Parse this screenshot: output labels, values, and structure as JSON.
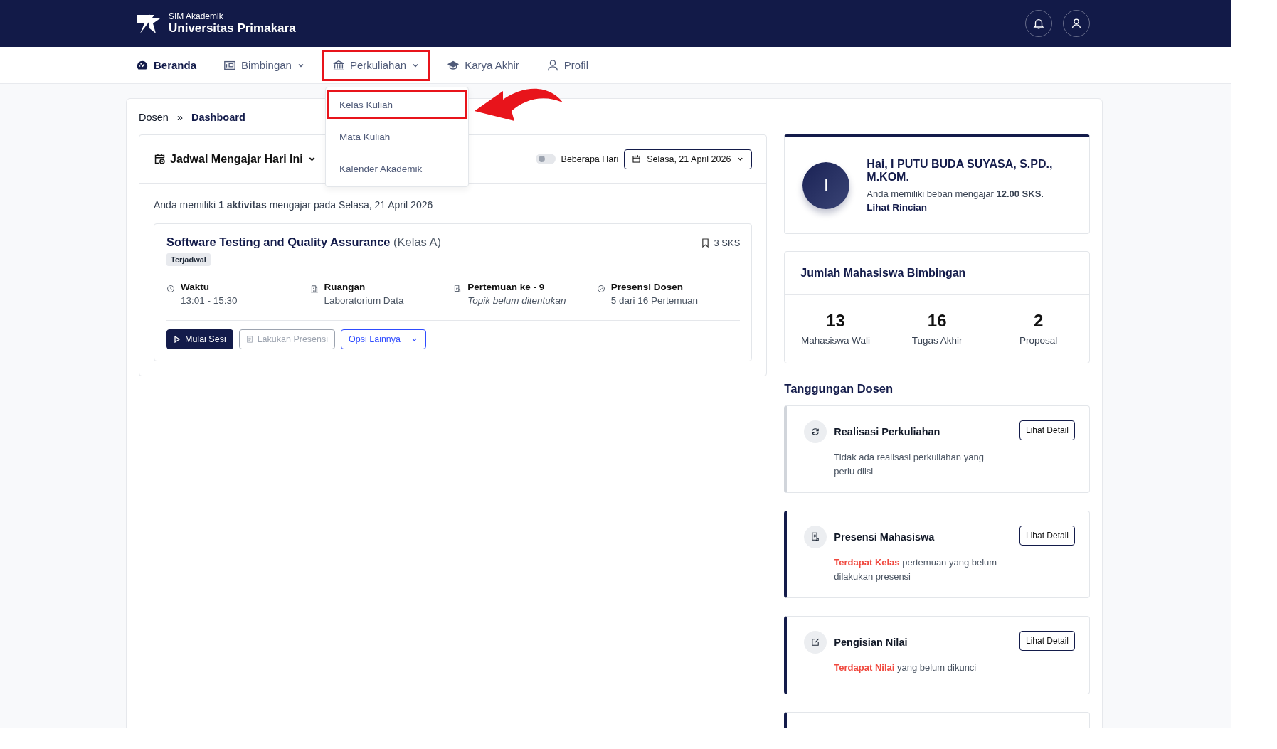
{
  "header": {
    "subtitle": "SIM Akademik",
    "title": "Universitas Primakara"
  },
  "nav": [
    {
      "label": "Beranda",
      "kind": "gauge",
      "selected": true,
      "has_menu": false,
      "highlighted": false
    },
    {
      "label": "Bimbingan",
      "kind": "board",
      "selected": false,
      "has_menu": true,
      "highlighted": false
    },
    {
      "label": "Perkuliahan",
      "kind": "bank",
      "selected": false,
      "has_menu": true,
      "highlighted": true,
      "menu": [
        {
          "label": "Kelas Kuliah",
          "highlighted": true
        },
        {
          "label": "Mata Kuliah",
          "highlighted": false
        },
        {
          "label": "Kalender Akademik",
          "highlighted": false
        }
      ]
    },
    {
      "label": "Karya Akhir",
      "kind": "cap",
      "selected": false,
      "has_menu": false,
      "highlighted": false
    },
    {
      "label": "Profil",
      "kind": "person",
      "selected": false,
      "has_menu": false,
      "highlighted": false
    }
  ],
  "breadcrumb": {
    "separator": "»",
    "items": [
      "Dosen",
      "Dashboard"
    ]
  },
  "schedule": {
    "title": "Jadwal Mengajar Hari Ini",
    "toggle": {
      "label": "Beberapa Hari",
      "on": false
    },
    "date": "Selasa, 21 April 2026",
    "summary": "Anda memiliki **1 aktivitas** mengajar pada Selasa, 21 April 2026",
    "courses": [
      {
        "title": "Software Testing and Quality Assurance",
        "class_label": "(Kelas A)",
        "status": "Terjadwal",
        "credits": "3 SKS",
        "info": [
          {
            "kind": "clock",
            "label": "Waktu",
            "value": "13:01 - 15:30",
            "italic": false
          },
          {
            "kind": "building",
            "label": "Ruangan",
            "value": "Laboratorium Data",
            "italic": false
          },
          {
            "kind": "document",
            "label": "Pertemuan ke - 9",
            "value": "Topik belum ditentukan",
            "italic": true
          },
          {
            "kind": "check",
            "label": "Presensi Dosen",
            "value": "5 dari 16 Pertemuan",
            "italic": false
          }
        ],
        "buttons": [
          {
            "kind": "primary",
            "label": "Mulai Sesi",
            "disabled": false
          },
          {
            "kind": "presence",
            "label": "Lakukan Presensi",
            "disabled": true
          },
          {
            "kind": "dropdown",
            "label": "Opsi Lainnya",
            "disabled": false
          }
        ]
      }
    ]
  },
  "profile": {
    "initial": "I",
    "greeting": "Hai, I PUTU BUDA SUYASA, S.PD., M.KOM.",
    "load": "Anda memiliki beban mengajar **12.00 SKS.**",
    "link": "Lihat Rincian"
  },
  "supervision": {
    "title": "Jumlah Mahasiswa Bimbingan",
    "stats": [
      {
        "value": "13",
        "label": "Mahasiswa Wali"
      },
      {
        "value": "16",
        "label": "Tugas Akhir"
      },
      {
        "value": "2",
        "label": "Proposal"
      }
    ]
  },
  "tasks": {
    "title": "Tanggungan Dosen",
    "items": [
      {
        "kind": "refresh",
        "title": "Realisasi Perkuliahan",
        "pending": false,
        "text": "Tidak ada realisasi perkuliahan yang perlu diisi",
        "button": "Lihat Detail"
      },
      {
        "kind": "document",
        "title": "Presensi Mahasiswa",
        "pending": true,
        "highlight": "Terdapat Kelas",
        "text": "pertemuan yang belum dilakukan presensi",
        "button": "Lihat Detail"
      },
      {
        "kind": "edit",
        "title": "Pengisian Nilai",
        "pending": true,
        "highlight": "Terdapat Nilai",
        "text": "yang belum dikunci",
        "button": "Lihat Detail"
      }
    ]
  }
}
